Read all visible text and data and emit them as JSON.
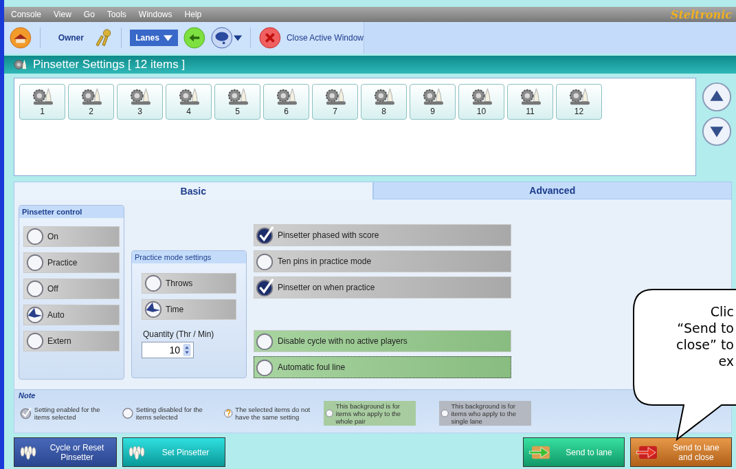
{
  "menu": [
    "Console",
    "View",
    "Go",
    "Tools",
    "Windows",
    "Help"
  ],
  "brand": "Steltronic",
  "toolbar": {
    "user": "Owner",
    "lanes": "Lanes",
    "close": "Close Active Window"
  },
  "title": "Pinsetter Settings [ 12 items ]",
  "pinsetters": [
    {
      "label": "1",
      "selected": false
    },
    {
      "label": "2",
      "selected": false
    },
    {
      "label": "3",
      "selected": false
    },
    {
      "label": "4",
      "selected": false
    },
    {
      "label": "5",
      "selected": false
    },
    {
      "label": "6",
      "selected": false
    },
    {
      "label": "7",
      "selected": false
    },
    {
      "label": "8",
      "selected": false
    },
    {
      "label": "9",
      "selected": false
    },
    {
      "label": "10",
      "selected": false
    },
    {
      "label": "11",
      "selected": false
    },
    {
      "label": "12",
      "selected": false
    }
  ],
  "tabs": [
    {
      "label": "Basic",
      "selected": true
    },
    {
      "label": "Advanced",
      "selected": false
    }
  ],
  "pinsetter_control": {
    "title": "Pinsetter control",
    "options": [
      {
        "label": "On",
        "selected": false
      },
      {
        "label": "Practice",
        "selected": false
      },
      {
        "label": "Off",
        "selected": false
      },
      {
        "label": "Auto",
        "selected": true
      },
      {
        "label": "Extern",
        "selected": false
      }
    ]
  },
  "practice_mode": {
    "title": "Practice mode settings",
    "options": [
      {
        "label": "Throws",
        "selected": false
      },
      {
        "label": "Time",
        "selected": true
      }
    ],
    "quantity_label": "Quantity (Thr / Min)",
    "quantity": "10"
  },
  "settings": [
    {
      "label": "Pinsetter phased with score",
      "checked": true,
      "kind": "single",
      "focused": false
    },
    {
      "label": "Ten pins in practice mode",
      "checked": false,
      "kind": "single",
      "focused": false
    },
    {
      "label": "Pinsetter on when practice",
      "checked": true,
      "kind": "single",
      "focused": false
    },
    {
      "label": "Disable cycle with no active players",
      "checked": false,
      "kind": "pair",
      "focused": false
    },
    {
      "label": "Automatic foul line",
      "checked": false,
      "kind": "pair",
      "focused": true
    }
  ],
  "note": {
    "title": "Note",
    "items": [
      {
        "kind": "enabled",
        "text": "Setting enabled for the items selected"
      },
      {
        "kind": "disabled",
        "text": "Setting disabled for the items selected"
      },
      {
        "kind": "mixed",
        "text": "The selected items do not have the same setting"
      },
      {
        "kind": "pair",
        "text": "This background is for items who apply to the whole pair"
      },
      {
        "kind": "single",
        "text": "This background is for items who apply to the single lane"
      }
    ]
  },
  "buttons": [
    {
      "label": "Cycle or Reset Pinsetter",
      "kind": "cycle"
    },
    {
      "label": "Set Pinsetter",
      "kind": "set"
    },
    {
      "label": "Send to lane",
      "kind": "send"
    },
    {
      "label": "Send to lane and close",
      "kind": "send_close"
    }
  ],
  "callout": {
    "lines": [
      "Clic",
      "“Send to",
      "close” to",
      "ex"
    ]
  }
}
